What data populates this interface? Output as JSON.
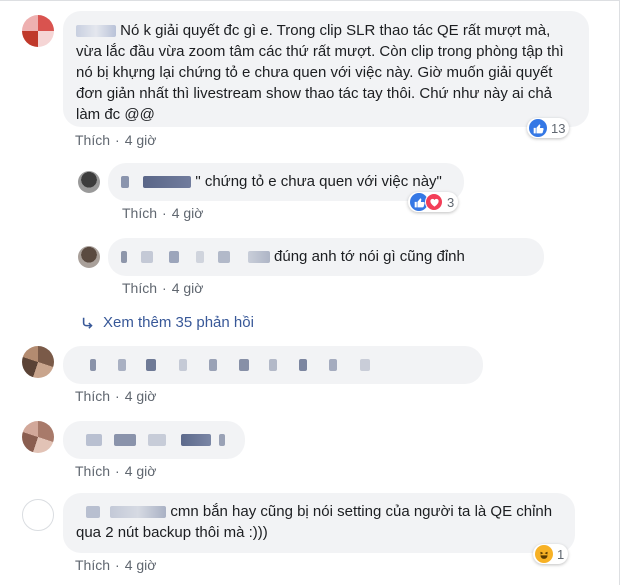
{
  "comments": [
    {
      "text": "Nó k giải quyết đc gì e. Trong clip SLR thao tác QE rất mượt mà, vừa lắc đầu vừa zoom tâm các thứ rất mượt. Còn clip trong phòng tập thì nó bị khựng lại chứng tỏ e chưa quen với việc này. Giờ muốn giải quyết đơn giản nhất thì livestream show thao tác tay thôi. Chứ như này ai chả làm đc @@",
      "like": "Thích",
      "time": "4 giờ",
      "reactions": "13"
    },
    {
      "text": "\" chứng tỏ e chưa quen với việc này\"",
      "like": "Thích",
      "time": "4 giờ",
      "reactions": "3"
    },
    {
      "text": "đúng anh tớ nói gì cũng đỉnh",
      "like": "Thích",
      "time": "4 giờ"
    },
    {
      "like": "Thích",
      "time": "4 giờ"
    },
    {
      "like": "Thích",
      "time": "4 giờ"
    },
    {
      "text": "cmn bắn hay cũng bị nói setting của người ta là QE chỉnh qua 2 nút backup thôi mà :)))",
      "like": "Thích",
      "time": "4 giờ",
      "reactions": "1"
    }
  ],
  "more_replies": "Xem thêm 35 phản hồi",
  "colors": {
    "like_blue": "#3578e5",
    "heart_red": "#f33e58",
    "haha_yellow": "#f7b125",
    "link": "#385898",
    "bubble": "#f2f3f5"
  },
  "icons": [
    "like-icon",
    "love-icon",
    "haha-icon",
    "reply-arrow-icon"
  ]
}
